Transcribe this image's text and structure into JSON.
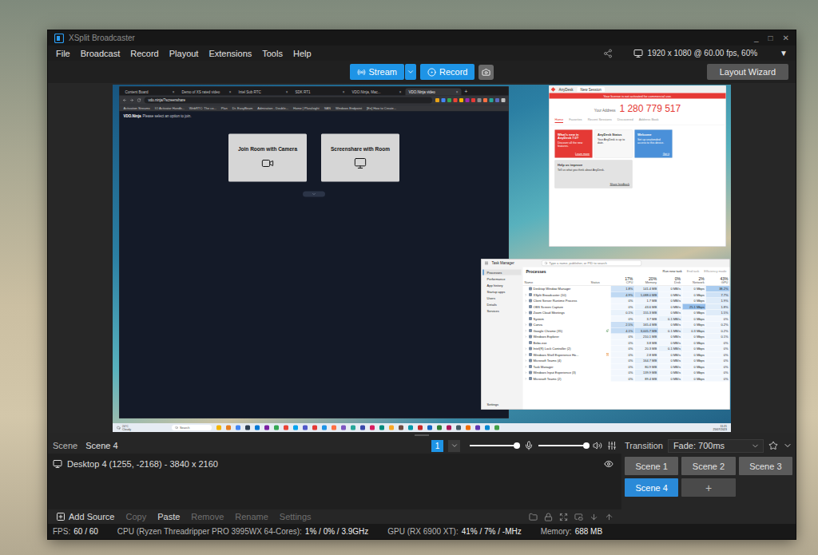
{
  "window": {
    "title": "XSplit Broadcaster",
    "controls": [
      "_",
      "□",
      "✕"
    ]
  },
  "menu": [
    "File",
    "Broadcast",
    "Record",
    "Playout",
    "Extensions",
    "Tools",
    "Help"
  ],
  "output": {
    "label": "1920 x 1080 @ 60.00 fps, 60%",
    "caret": "▼"
  },
  "toolbar": {
    "stream": "Stream",
    "record": "Record",
    "layout_wizard": "Layout Wizard"
  },
  "preview": {
    "browser": {
      "tabs": [
        {
          "label": "Content Board",
          "selected": false
        },
        {
          "label": "Demo of XS rated video",
          "selected": false
        },
        {
          "label": "Intel Sub RTC",
          "selected": false
        },
        {
          "label": "SDK RT1",
          "selected": false
        },
        {
          "label": "VDO.Ninja, Mac...",
          "selected": false
        },
        {
          "label": "VDO.Ninja video",
          "selected": true
        }
      ],
      "close": "×",
      "new_tab": "+",
      "address": "vdo.ninja/?screenshare",
      "bookmarks": [
        "Activation Streams",
        "IO Activator Handb...",
        "WebRTC: The co...",
        "Plan",
        "Dr. EasyBeam",
        "Admiration - Double...",
        "Home | Pluralsight",
        "SAN",
        "Windows Endpoint",
        "[En] How to Create..."
      ],
      "extensions": [
        {
          "color": "#e8a317"
        },
        {
          "color": "#4285f4"
        },
        {
          "color": "#34a853"
        },
        {
          "color": "#ea4335"
        },
        {
          "color": "#f4b400"
        },
        {
          "color": "#9c27b0"
        },
        {
          "color": "#e53935"
        },
        {
          "color": "#8d8d8d"
        },
        {
          "color": "#ff7043"
        },
        {
          "color": "#26a69a"
        },
        {
          "color": "#5c6bc0"
        },
        {
          "color": "#c0c0c0"
        }
      ],
      "page": {
        "brand": "VDO.Ninja",
        "prompt": "Please select an option to join.",
        "options": [
          {
            "label": "Join Room with Camera",
            "kind": "camera"
          },
          {
            "label": "Screenshare with Room",
            "kind": "screen"
          }
        ]
      }
    },
    "anydesk": {
      "title": "AnyDesk",
      "tab": "New Session",
      "banner": "Your license is not activated for commercial use.",
      "address_label": "Your Address",
      "address": "1 280 779 517",
      "nav": [
        {
          "label": "Home",
          "selected": true
        },
        {
          "label": "Favorites",
          "selected": false
        },
        {
          "label": "Recent Sessions",
          "selected": false
        },
        {
          "label": "Discovered",
          "selected": false
        },
        {
          "label": "Address Book",
          "selected": false
        }
      ],
      "cards": [
        {
          "title": "What's new in AnyDesk 7.0?",
          "text": "Discover all the new features.",
          "action": "Learn more",
          "color": "#e53935",
          "wide": false
        },
        {
          "title": "AnyDesk Status",
          "text": "Your AnyDesk is up to date.",
          "action": "",
          "color": "#f7f7f7",
          "wide": false
        },
        {
          "title": "Welcome",
          "text": "Set up unattended access to this device.",
          "action": "Got it",
          "color": "#4a90d9",
          "wide": false
        },
        {
          "title": "Help us improve",
          "text": "Tell us what you think about AnyDesk.",
          "action": "Share feedback",
          "color": "#e3e3e3",
          "wide": true
        }
      ]
    },
    "task_manager": {
      "title": "Task Manager",
      "search": "Type a name, publisher, or PID to search",
      "nav": [
        {
          "label": "Processes",
          "selected": true
        },
        {
          "label": "Performance",
          "selected": false
        },
        {
          "label": "App history",
          "selected": false
        },
        {
          "label": "Startup apps",
          "selected": false
        },
        {
          "label": "Users",
          "selected": false
        },
        {
          "label": "Details",
          "selected": false
        },
        {
          "label": "Services",
          "selected": false
        }
      ],
      "settings": "Settings",
      "page": "Processes",
      "actions": [
        {
          "label": "Run new task",
          "disabled": false
        },
        {
          "label": "End task",
          "disabled": true
        },
        {
          "label": "Efficiency mode",
          "disabled": true
        }
      ],
      "name_columns": [
        "Name",
        "Status"
      ],
      "metric_columns": [
        {
          "label": "CPU",
          "total": "17%"
        },
        {
          "label": "Memory",
          "total": "20%"
        },
        {
          "label": "Disk",
          "total": "0%"
        },
        {
          "label": "Network",
          "total": "2%"
        },
        {
          "label": "GPU",
          "total": "43%"
        }
      ],
      "rows": [
        {
          "name": "Desktop Window Manager",
          "expandable": false,
          "efficiency": false,
          "suspended": false,
          "cells": [
            "1.8%",
            "141.4 MB",
            "0 MB/s",
            "0 Mbps",
            "38.2%"
          ],
          "heat": [
            0.35,
            0.15,
            0.02,
            0.02,
            0.7
          ]
        },
        {
          "name": "XSplit Broadcaster (10)",
          "expandable": true,
          "efficiency": false,
          "suspended": false,
          "cells": [
            "4.9%",
            "1,088.0 MB",
            "0 MB/s",
            "0 Mbps",
            "7.7%"
          ],
          "heat": [
            0.5,
            0.45,
            0.02,
            0.02,
            0.35
          ]
        },
        {
          "name": "Client Server Runtime Process",
          "expandable": true,
          "efficiency": false,
          "suspended": false,
          "cells": [
            "0%",
            "1.7 MB",
            "0 MB/s",
            "0 Mbps",
            "1.9%"
          ],
          "heat": [
            0.02,
            0.05,
            0.02,
            0.02,
            0.2
          ]
        },
        {
          "name": "OBS Screen Capture",
          "expandable": false,
          "efficiency": false,
          "suspended": false,
          "cells": [
            "0%",
            "43.6 MB",
            "0 MB/s",
            "25.1 Mbps",
            "1.8%"
          ],
          "heat": [
            0.02,
            0.1,
            0.02,
            0.9,
            0.2
          ]
        },
        {
          "name": "Zoom Cloud Meetings",
          "expandable": true,
          "efficiency": false,
          "suspended": false,
          "cells": [
            "0.1%",
            "155.3 MB",
            "0 MB/s",
            "0 Mbps",
            "1.5%"
          ],
          "heat": [
            0.1,
            0.15,
            0.02,
            0.02,
            0.2
          ]
        },
        {
          "name": "System",
          "expandable": false,
          "efficiency": false,
          "suspended": false,
          "cells": [
            "0%",
            "3.7 MB",
            "0.1 MB/s",
            "0 Mbps",
            "0%"
          ],
          "heat": [
            0.02,
            0.05,
            0.1,
            0.02,
            0.02
          ]
        },
        {
          "name": "Canva",
          "expandable": true,
          "efficiency": false,
          "suspended": false,
          "cells": [
            "2.5%",
            "165.4 MB",
            "0 MB/s",
            "0 Mbps",
            "0.2%"
          ],
          "heat": [
            0.4,
            0.15,
            0.02,
            0.02,
            0.05
          ]
        },
        {
          "name": "Google Chrome (35)",
          "expandable": true,
          "efficiency": true,
          "suspended": false,
          "cells": [
            "4.1%",
            "3,005.7 MB",
            "0.1 MB/s",
            "0.3 Mbps",
            "0.2%"
          ],
          "heat": [
            0.45,
            0.5,
            0.1,
            0.1,
            0.05
          ]
        },
        {
          "name": "Windows Explorer",
          "expandable": true,
          "efficiency": false,
          "suspended": false,
          "cells": [
            "0%",
            "210.1 MB",
            "0 MB/s",
            "0 Mbps",
            "0.1%"
          ],
          "heat": [
            0.02,
            0.15,
            0.02,
            0.02,
            0.05
          ]
        },
        {
          "name": "Bebo.exe",
          "expandable": false,
          "efficiency": false,
          "suspended": false,
          "cells": [
            "0%",
            "3.8 MB",
            "0 MB/s",
            "0 Mbps",
            "0%"
          ],
          "heat": [
            0.02,
            0.05,
            0.02,
            0.02,
            0.02
          ]
        },
        {
          "name": "Intel(R) Lock Controller (2)",
          "expandable": true,
          "efficiency": false,
          "suspended": false,
          "cells": [
            "0%",
            "20.3 MB",
            "0.1 MB/s",
            "0 Mbps",
            "0%"
          ],
          "heat": [
            0.02,
            0.05,
            0.1,
            0.02,
            0.02
          ]
        },
        {
          "name": "Windows Shell Experience Ho...",
          "expandable": true,
          "efficiency": false,
          "suspended": true,
          "cells": [
            "0%",
            "2.8 MB",
            "0 MB/s",
            "0 Mbps",
            "0%"
          ],
          "heat": [
            0.02,
            0.05,
            0.02,
            0.02,
            0.02
          ]
        },
        {
          "name": "Microsoft Teams (4)",
          "expandable": true,
          "efficiency": false,
          "suspended": false,
          "cells": [
            "0%",
            "164.7 MB",
            "0 MB/s",
            "0 Mbps",
            "0%"
          ],
          "heat": [
            0.02,
            0.15,
            0.02,
            0.02,
            0.02
          ]
        },
        {
          "name": "Task Manager",
          "expandable": true,
          "efficiency": false,
          "suspended": false,
          "cells": [
            "0%",
            "80.9 MB",
            "0 MB/s",
            "0 Mbps",
            "0%"
          ],
          "heat": [
            0.02,
            0.1,
            0.02,
            0.02,
            0.02
          ]
        },
        {
          "name": "Windows Input Experience (3)",
          "expandable": true,
          "efficiency": false,
          "suspended": false,
          "cells": [
            "0%",
            "139.9 MB",
            "0 MB/s",
            "0 Mbps",
            "0%"
          ],
          "heat": [
            0.02,
            0.15,
            0.02,
            0.02,
            0.02
          ]
        },
        {
          "name": "Microsoft Teams (2)",
          "expandable": true,
          "efficiency": false,
          "suspended": false,
          "cells": [
            "0%",
            "89.4 MB",
            "0 MB/s",
            "0 Mbps",
            "0%"
          ],
          "heat": [
            0.02,
            0.1,
            0.02,
            0.02,
            0.02
          ]
        }
      ]
    },
    "taskbar": {
      "weather": {
        "temp": "24°C",
        "condition": "Cloudy"
      },
      "search": "Search",
      "apps": [
        {
          "color": "#f4b400"
        },
        {
          "color": "#e67e22"
        },
        {
          "color": "#4285f4"
        },
        {
          "color": "#2c3e50"
        },
        {
          "color": "#0078d4"
        },
        {
          "color": "#7b1fa2"
        },
        {
          "color": "#34a853"
        },
        {
          "color": "#ea4335"
        },
        {
          "color": "#00a4ef"
        },
        {
          "color": "#5059c9"
        },
        {
          "color": "#e53935"
        },
        {
          "color": "#1e94e6"
        },
        {
          "color": "#ff7043"
        },
        {
          "color": "#7e57c2"
        },
        {
          "color": "#26a69a"
        },
        {
          "color": "#3949ab"
        },
        {
          "color": "#d81b60"
        },
        {
          "color": "#00897b"
        },
        {
          "color": "#f9a825"
        },
        {
          "color": "#6d4c41"
        },
        {
          "color": "#0097a7"
        },
        {
          "color": "#c62828"
        },
        {
          "color": "#1565c0"
        },
        {
          "color": "#2e7d32"
        },
        {
          "color": "#ad1457"
        },
        {
          "color": "#455a64"
        },
        {
          "color": "#ef6c00"
        },
        {
          "color": "#5e35b1"
        },
        {
          "color": "#0288d1"
        },
        {
          "color": "#43a047"
        }
      ],
      "time": "11:21",
      "date": "25/07/2023"
    }
  },
  "scene": {
    "label": "Scene",
    "name": "Scene 4"
  },
  "audio": {
    "track": "1",
    "sliders": [
      {
        "kind": "mic",
        "level": 0.95
      },
      {
        "kind": "speaker",
        "level": 0.97
      }
    ]
  },
  "sources": [
    {
      "label": "Desktop 4 (1255, -2168) - 3840 x 2160",
      "visible": true
    }
  ],
  "source_actions": [
    {
      "label": "Add Source",
      "disabled": false
    },
    {
      "label": "Copy",
      "disabled": true
    },
    {
      "label": "Paste",
      "disabled": false
    },
    {
      "label": "Remove",
      "disabled": true
    },
    {
      "label": "Rename",
      "disabled": true
    },
    {
      "label": "Settings",
      "disabled": true
    }
  ],
  "transition": {
    "label": "Transition",
    "value": "Fade: 700ms"
  },
  "scenes": [
    {
      "label": "Scene 1",
      "selected": false
    },
    {
      "label": "Scene 2",
      "selected": false
    },
    {
      "label": "Scene 3",
      "selected": false
    },
    {
      "label": "Scene 4",
      "selected": true
    }
  ],
  "add_scene": "+",
  "status_bar": [
    {
      "label": "FPS:",
      "value": "60 / 60"
    },
    {
      "label": "CPU (Ryzen Threadripper PRO 3995WX 64-Cores):",
      "value": "1% / 0% / 3.9GHz"
    },
    {
      "label": "GPU (RX 6900 XT):",
      "value": "41% / 7% / -MHz"
    },
    {
      "label": "Memory:",
      "value": "688 MB"
    }
  ]
}
